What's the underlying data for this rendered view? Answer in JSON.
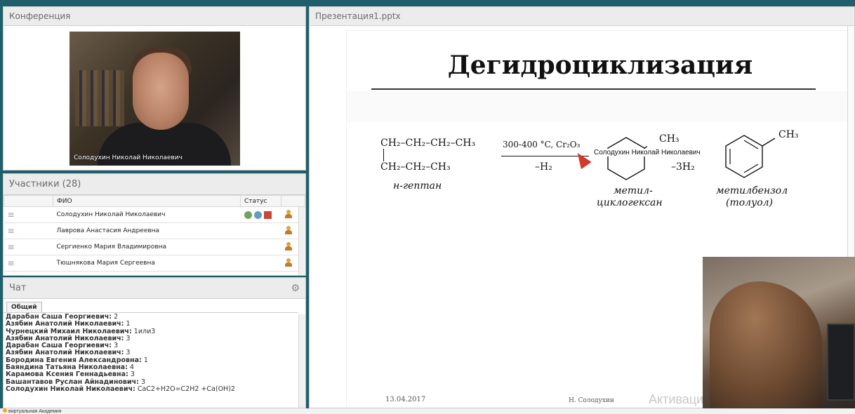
{
  "conference": {
    "title": "Конференция",
    "video_caption": "Солодухин Николай  Николаевич"
  },
  "participants": {
    "title": "Участники (28)",
    "columns": [
      "ФИО",
      "Статус"
    ],
    "rows": [
      {
        "name": "Солодухин Николай   Николаевич"
      },
      {
        "name": "Лаврова Анастасия  Андреевна"
      },
      {
        "name": "Сергиенко Мария Владимировна"
      },
      {
        "name": "Тюшнякова Мария Сергеевна"
      }
    ]
  },
  "chat": {
    "title": "Чат",
    "tab": "Общий",
    "messages": [
      {
        "who": "Дарабан Саша Георгиевич:",
        "text": "2"
      },
      {
        "who": "Азябин Анатолий Николаевич:",
        "text": "1"
      },
      {
        "who": "Чурнецкий Михаил Николаевич:",
        "text": "1или3"
      },
      {
        "who": "Азябин Анатолий Николаевич:",
        "text": "3"
      },
      {
        "who": "Дарабан Саша Георгиевич:",
        "text": "3"
      },
      {
        "who": "Азябин Анатолий Николаевич:",
        "text": "3"
      },
      {
        "who": "Бородина Евгения Александровна:",
        "text": "1"
      },
      {
        "who": "Баяндина Татьяна Николаевна:",
        "text": "4"
      },
      {
        "who": "Карамова Ксения Геннадьевна:",
        "text": "3"
      },
      {
        "who": "Башантавов Руслан Айнадинович:",
        "text": "3"
      },
      {
        "who": "Солодухин Николай   Николаевич:",
        "text": "CaC2+H2O=C2H2 +Ca(OH)2"
      }
    ]
  },
  "presentation": {
    "filename": "Презентация1.pptx",
    "slide": {
      "title": "Дегидроциклизация",
      "heptane_line1": "CH₂–CH₂–CH₂–CH₃",
      "heptane_line2": "CH₂–CH₂–CH₃",
      "heptane_name": "н-гептан",
      "conditions": "300-400 °C, Cr₂O₃",
      "minus_h2": "–H₂",
      "ch3_a": "CH₃",
      "minus_3h2": "–3H₂",
      "ch3_b": "CH₃",
      "methylcyclohexane_1": "метил-",
      "methylcyclohexane_2": "циклогексан",
      "toluene_1": "метилбензол",
      "toluene_2": "(толуол)",
      "date": "13.04.2017",
      "author": "Н. Солодухин",
      "watermark": "Активаци"
    },
    "pointer_label": "Солодухин Николай  Николаевич"
  },
  "taskbar": {
    "app": "виртуальная Академия"
  }
}
